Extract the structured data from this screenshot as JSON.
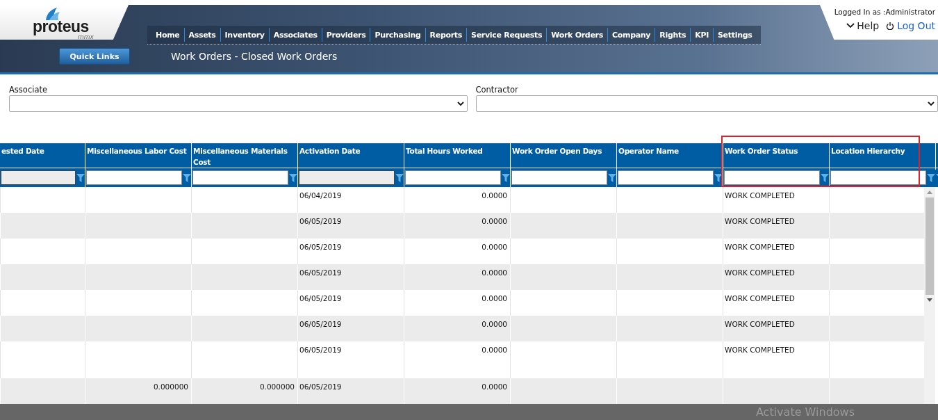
{
  "logo": {
    "name": "proteus",
    "sub": "mmx"
  },
  "nav": [
    "Home",
    "Assets",
    "Inventory",
    "Associates",
    "Providers",
    "Purchasing",
    "Reports",
    "Service Requests",
    "Work Orders",
    "Company",
    "Rights",
    "KPI",
    "Settings"
  ],
  "quick_links": "Quick Links",
  "page_title": "Work Orders - Closed Work Orders",
  "user": {
    "logged_in": "Logged In as :Administrator",
    "help": "Help",
    "logout": "Log Out"
  },
  "filters": [
    {
      "label": "Associate"
    },
    {
      "label": "Contractor"
    }
  ],
  "table": {
    "columns": [
      {
        "title": "ested Date",
        "kind": "date",
        "filter_disabled": true
      },
      {
        "title": "Miscellaneous Labor Cost",
        "kind": "number",
        "filter_disabled": false
      },
      {
        "title": "Miscellaneous Materials Cost",
        "kind": "number",
        "filter_disabled": false
      },
      {
        "title": "Activation Date",
        "kind": "date",
        "filter_disabled": true
      },
      {
        "title": "Total Hours Worked",
        "kind": "number",
        "filter_disabled": false
      },
      {
        "title": "Work Order Open Days",
        "kind": "number",
        "filter_disabled": false
      },
      {
        "title": "Operator Name",
        "kind": "text",
        "filter_disabled": false
      },
      {
        "title": "Work Order Status",
        "kind": "text",
        "filter_disabled": false,
        "highlighted": true
      },
      {
        "title": "Location Hierarchy",
        "kind": "text",
        "filter_disabled": false,
        "highlighted": true
      }
    ],
    "rows": [
      {
        "cells": [
          null,
          null,
          null,
          "06/04/2019",
          "0.0000",
          null,
          null,
          "WORK COMPLETED",
          null
        ]
      },
      {
        "cells": [
          null,
          null,
          null,
          "06/05/2019",
          "0.0000",
          null,
          null,
          "WORK COMPLETED",
          null
        ]
      },
      {
        "cells": [
          null,
          null,
          null,
          "06/05/2019",
          "0.0000",
          null,
          null,
          "WORK COMPLETED",
          null
        ]
      },
      {
        "cells": [
          null,
          null,
          null,
          "06/05/2019",
          "0.0000",
          null,
          null,
          "WORK COMPLETED",
          null
        ]
      },
      {
        "cells": [
          null,
          null,
          null,
          "06/05/2019",
          "0.0000",
          null,
          null,
          "WORK COMPLETED",
          null
        ]
      },
      {
        "cells": [
          null,
          null,
          null,
          "06/05/2019",
          "0.0000",
          null,
          null,
          "WORK COMPLETED",
          null
        ]
      },
      {
        "cells": [
          null,
          null,
          null,
          "06/05/2019",
          "0.0000",
          null,
          null,
          "WORK COMPLETED",
          null
        ],
        "tall": true
      },
      {
        "cells": [
          null,
          "0.000000",
          "0.000000",
          "06/05/2019",
          "0.0000",
          null,
          null,
          null,
          null
        ]
      }
    ]
  },
  "os_notice": "Activate Windows"
}
